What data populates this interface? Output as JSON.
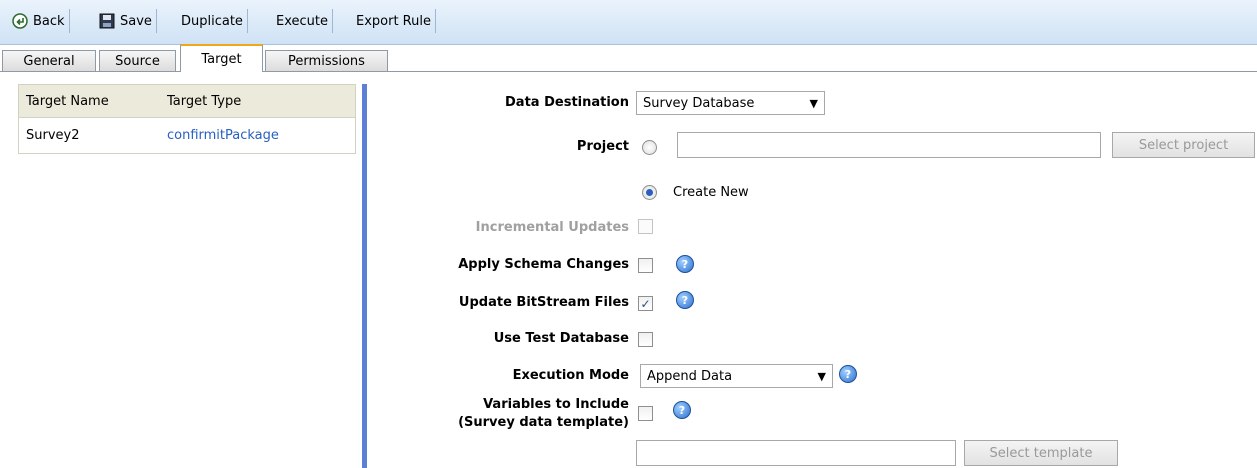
{
  "toolbar": {
    "back": "Back",
    "save": "Save",
    "duplicate": "Duplicate",
    "execute": "Execute",
    "export_rule": "Export Rule"
  },
  "tabs": {
    "general": "General",
    "source": "Source",
    "target": "Target",
    "permissions": "Permissions"
  },
  "target_list": {
    "col_name": "Target Name",
    "col_type": "Target Type",
    "rows": [
      {
        "name": "Survey2",
        "type": "confirmitPackage"
      }
    ]
  },
  "form": {
    "data_destination_label": "Data Destination",
    "data_destination_value": "Survey Database",
    "project_label": "Project",
    "project_value": "",
    "select_project": "Select project",
    "create_new": "Create New",
    "incremental_label": "Incremental Updates",
    "schema_label": "Apply Schema Changes",
    "bitstream_label": "Update BitStream Files",
    "bitstream_checked": true,
    "test_db_label": "Use Test Database",
    "exec_mode_label": "Execution Mode",
    "exec_mode_value": "Append Data",
    "variables_label_1": "Variables to Include",
    "variables_label_2": "(Survey data template)",
    "template_value": "",
    "select_template": "Select template"
  },
  "colors": {
    "accent_tab": "#f0a818",
    "divider": "#5b80d6",
    "link": "#2860c0"
  }
}
